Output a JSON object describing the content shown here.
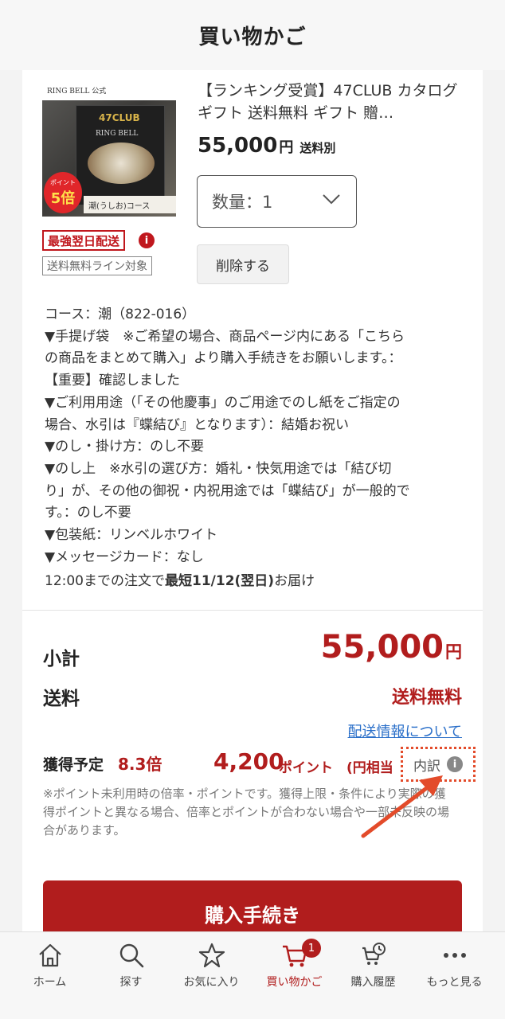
{
  "header": {
    "title": "買い物かご"
  },
  "product": {
    "image": {
      "brand": "RING BELL 公式",
      "logo": "47CLUB",
      "subbrand": "RING BELL",
      "point_badge_small": "ポイント",
      "point_badge_big": "5倍",
      "course": "潮(うしお)コース"
    },
    "title": "【ランキング受賞】47CLUB カタログギフト 送料無料 ギフト 贈…",
    "price": "55,000",
    "price_unit": "円",
    "shipping_note": "送料別",
    "quantity_label": "数量：1",
    "delete_label": "削除する",
    "tag_next_day": "最強翌日配送",
    "tag_free_line": "送料無料ライン対象"
  },
  "options": [
    "コース：潮（822-016）",
    "▼手提げ袋　※ご希望の場合、商品ページ内にある「こちら",
    "の商品をまとめて購入」より購入手続きをお願いします。：",
    "【重要】確認しました",
    "▼ご利用用途（「その他慶事」のご用途でのし紙をご指定の",
    "場合、水引は『蝶結び』となります）：結婚お祝い",
    "▼のし・掛け方：のし不要",
    "▼のし上　※水引の選び方：婚礼・快気用途では「結び切",
    "り」が、その他の御祝・内祝用途では「蝶結び」が一般的で",
    "す。：のし不要",
    "▼包装紙：リンベルホワイト",
    "▼メッセージカード：なし"
  ],
  "delivery": {
    "prefix": "12:00までの注文で",
    "date": "最短11/12(翌日)",
    "suffix": "お届け"
  },
  "summary": {
    "subtotal_label": "小計",
    "subtotal_value": "55,000",
    "subtotal_unit": "円",
    "shipping_label": "送料",
    "shipping_value": "送料無料",
    "shipping_link": "配送情報について",
    "points_label": "獲得予定",
    "points_multiplier": "8.3倍",
    "points_value": "4,200",
    "points_unit": "ポイント",
    "points_equiv": "(円相当",
    "breakdown_label": "内訳",
    "note": "※ポイント未利用時の倍率・ポイントです。獲得上限・条件により実際の獲得ポイントと異なる場合、倍率とポイントが合わない場合や一部未反映の場合があります。",
    "annotation_color": "#e34b2a"
  },
  "buy_button": "購入手続き",
  "tabbar": {
    "items": [
      {
        "label": "ホーム",
        "icon": "home-icon"
      },
      {
        "label": "探す",
        "icon": "search-icon"
      },
      {
        "label": "お気に入り",
        "icon": "star-icon"
      },
      {
        "label": "買い物かご",
        "icon": "cart-icon",
        "active": true,
        "badge": "1"
      },
      {
        "label": "購入履歴",
        "icon": "history-icon"
      },
      {
        "label": "もっと見る",
        "icon": "more-icon"
      }
    ]
  },
  "colors": {
    "accent": "#b11d1d",
    "link": "#2a6fc9"
  }
}
